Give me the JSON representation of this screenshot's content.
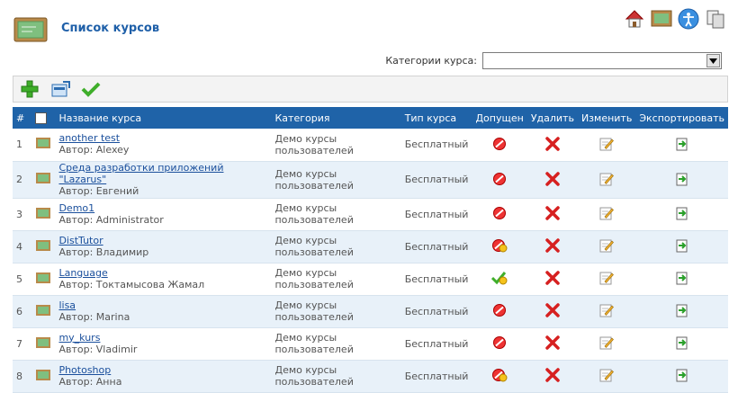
{
  "page": {
    "title": "Список курсов"
  },
  "filter": {
    "label": "Категории курса:",
    "selected": ""
  },
  "table": {
    "headers": {
      "num": "#",
      "name": "Название курса",
      "category": "Категория",
      "type": "Тип курса",
      "allowed": "Допущен",
      "delete": "Удалить",
      "edit": "Изменить",
      "export": "Экспортировать"
    },
    "rows": [
      {
        "n": "1",
        "name": "another test",
        "author": "Автор: Alexey",
        "cat1": "Демо курсы",
        "cat2": "пользователей",
        "type": "Бесплатный",
        "status": "blocked"
      },
      {
        "n": "2",
        "name": "Среда разработки приложений \"Lazarus\"",
        "author": "Автор: Евгений",
        "cat1": "Демо курсы",
        "cat2": "пользователей",
        "type": "Бесплатный",
        "status": "blocked"
      },
      {
        "n": "3",
        "name": "Demo1",
        "author": "Автор: Administrator",
        "cat1": "Демо курсы",
        "cat2": "пользователей",
        "type": "Бесплатный",
        "status": "blocked"
      },
      {
        "n": "4",
        "name": "DistTutor",
        "author": "Автор: Владимир",
        "cat1": "Демо курсы",
        "cat2": "пользователей",
        "type": "Бесплатный",
        "status": "pending"
      },
      {
        "n": "5",
        "name": "Language",
        "author": "Автор: Токтамысова Жамал",
        "cat1": "Демо курсы",
        "cat2": "пользователей",
        "type": "Бесплатный",
        "status": "approved"
      },
      {
        "n": "6",
        "name": "lisa",
        "author": "Автор: Marina",
        "cat1": "Демо курсы",
        "cat2": "пользователей",
        "type": "Бесплатный",
        "status": "blocked"
      },
      {
        "n": "7",
        "name": "my_kurs",
        "author": "Автор: Vladimir",
        "cat1": "Демо курсы",
        "cat2": "пользователей",
        "type": "Бесплатный",
        "status": "blocked"
      },
      {
        "n": "8",
        "name": "Photoshop",
        "author": "Автор: Анна",
        "cat1": "Демо курсы",
        "cat2": "пользователей",
        "type": "Бесплатный",
        "status": "pending"
      }
    ]
  },
  "icons": {
    "header_logo": "chalkboard-icon",
    "top": [
      "home-icon",
      "chalkboard-icon",
      "accessibility-icon",
      "copy-icon"
    ],
    "toolbar": [
      "add-icon",
      "import-icon",
      "checkmark-icon"
    ],
    "row_icon": "chalkboard-icon",
    "delete": "red-x-icon",
    "edit": "pencil-note-icon",
    "export": "export-icon"
  },
  "colors": {
    "header_bg": "#1f63a8",
    "alt_row": "#e8f1f9",
    "title": "#1e5fa8",
    "link": "#1a4f9c"
  }
}
